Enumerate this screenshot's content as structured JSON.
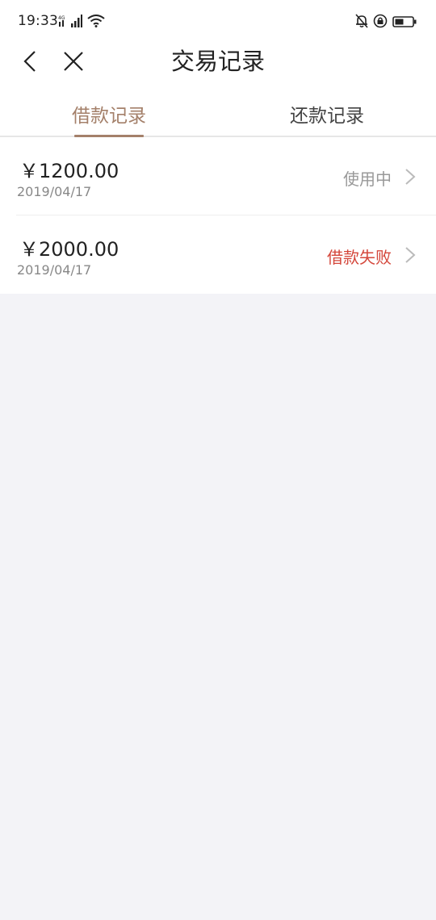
{
  "status_bar": {
    "time": "19:33",
    "icons": [
      "network-4g-icon",
      "signal-icon",
      "wifi-icon",
      "mute-bell-icon",
      "lock-rotation-icon",
      "battery-icon"
    ]
  },
  "nav": {
    "title": "交易记录",
    "back_icon": "chevron-left-icon",
    "close_icon": "close-icon"
  },
  "tabs": [
    {
      "label": "借款记录",
      "active": true
    },
    {
      "label": "还款记录",
      "active": false
    }
  ],
  "records": [
    {
      "amount": "￥1200.00",
      "date": "2019/04/17",
      "status": "使用中",
      "status_color": "#999999"
    },
    {
      "amount": "￥2000.00",
      "date": "2019/04/17",
      "status": "借款失败",
      "status_color": "#d4473b"
    }
  ],
  "colors": {
    "accent": "#a4806a",
    "failed": "#d4473b",
    "background": "#f3f3f7"
  }
}
